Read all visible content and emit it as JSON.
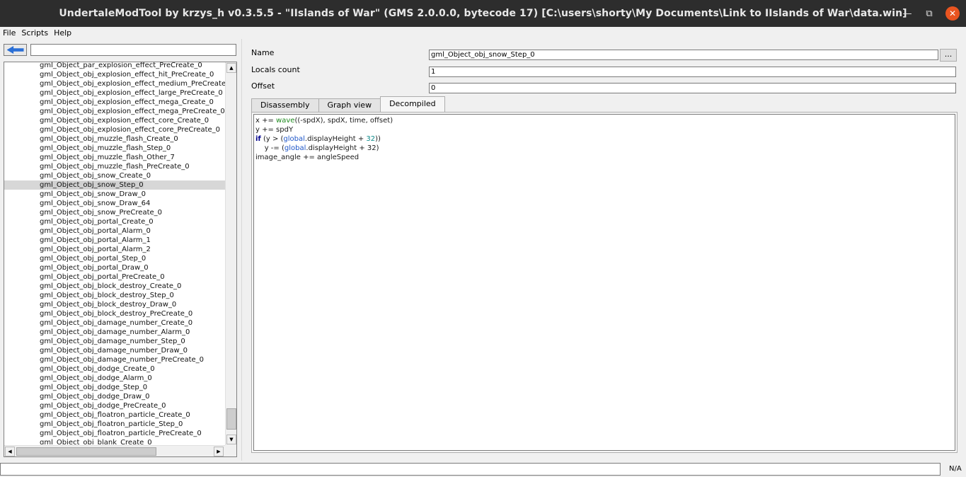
{
  "window": {
    "title": "UndertaleModTool by krzys_h v0.3.5.5 - \"IIslands of War\" (GMS 2.0.0.0, bytecode 17) [C:\\users\\shorty\\My Documents\\Link to IIslands of War\\data.win]",
    "minimize_glyph": "—",
    "maximize_glyph": "⧉",
    "close_glyph": "✕"
  },
  "menu": {
    "file": "File",
    "scripts": "Scripts",
    "help": "Help"
  },
  "sidebar": {
    "search_value": "",
    "selected_index": 13,
    "items": [
      "gml_Object_par_explosion_effect_PreCreate_0",
      "gml_Object_obj_explosion_effect_hit_PreCreate_0",
      "gml_Object_obj_explosion_effect_medium_PreCreate",
      "gml_Object_obj_explosion_effect_large_PreCreate_0",
      "gml_Object_obj_explosion_effect_mega_Create_0",
      "gml_Object_obj_explosion_effect_mega_PreCreate_0",
      "gml_Object_obj_explosion_effect_core_Create_0",
      "gml_Object_obj_explosion_effect_core_PreCreate_0",
      "gml_Object_obj_muzzle_flash_Create_0",
      "gml_Object_obj_muzzle_flash_Step_0",
      "gml_Object_obj_muzzle_flash_Other_7",
      "gml_Object_obj_muzzle_flash_PreCreate_0",
      "gml_Object_obj_snow_Create_0",
      "gml_Object_obj_snow_Step_0",
      "gml_Object_obj_snow_Draw_0",
      "gml_Object_obj_snow_Draw_64",
      "gml_Object_obj_snow_PreCreate_0",
      "gml_Object_obj_portal_Create_0",
      "gml_Object_obj_portal_Alarm_0",
      "gml_Object_obj_portal_Alarm_1",
      "gml_Object_obj_portal_Alarm_2",
      "gml_Object_obj_portal_Step_0",
      "gml_Object_obj_portal_Draw_0",
      "gml_Object_obj_portal_PreCreate_0",
      "gml_Object_obj_block_destroy_Create_0",
      "gml_Object_obj_block_destroy_Step_0",
      "gml_Object_obj_block_destroy_Draw_0",
      "gml_Object_obj_block_destroy_PreCreate_0",
      "gml_Object_obj_damage_number_Create_0",
      "gml_Object_obj_damage_number_Alarm_0",
      "gml_Object_obj_damage_number_Step_0",
      "gml_Object_obj_damage_number_Draw_0",
      "gml_Object_obj_damage_number_PreCreate_0",
      "gml_Object_obj_dodge_Create_0",
      "gml_Object_obj_dodge_Alarm_0",
      "gml_Object_obj_dodge_Step_0",
      "gml_Object_obj_dodge_Draw_0",
      "gml_Object_obj_dodge_PreCreate_0",
      "gml_Object_obj_floatron_particle_Create_0",
      "gml_Object_obj_floatron_particle_Step_0",
      "gml_Object_obj_floatron_particle_PreCreate_0",
      "gml_Object_obj_blank_Create_0"
    ]
  },
  "properties": {
    "name_label": "Name",
    "name_value": "gml_Object_obj_snow_Step_0",
    "browse_label": "...",
    "locals_label": "Locals count",
    "locals_value": "1",
    "offset_label": "Offset",
    "offset_value": "0"
  },
  "tabs": {
    "disassembly": "Disassembly",
    "graph_view": "Graph view",
    "decompiled": "Decompiled",
    "active": "decompiled"
  },
  "code": {
    "line1_a": "x += ",
    "line1_fn": "wave",
    "line1_b": "((-spdX), spdX, time, offset)",
    "line2": "y += spdY",
    "line3_kw": "if",
    "line3_a": " (y > (",
    "line3_gl": "global",
    "line3_b": ".displayHeight + ",
    "line3_num": "32",
    "line3_c": "))",
    "line4_a": "    y -= (",
    "line4_gl": "global",
    "line4_b": ".displayHeight + 32)",
    "line5": "image_angle += angleSpeed"
  },
  "status": {
    "field_value": "",
    "right_text": "N/A"
  }
}
